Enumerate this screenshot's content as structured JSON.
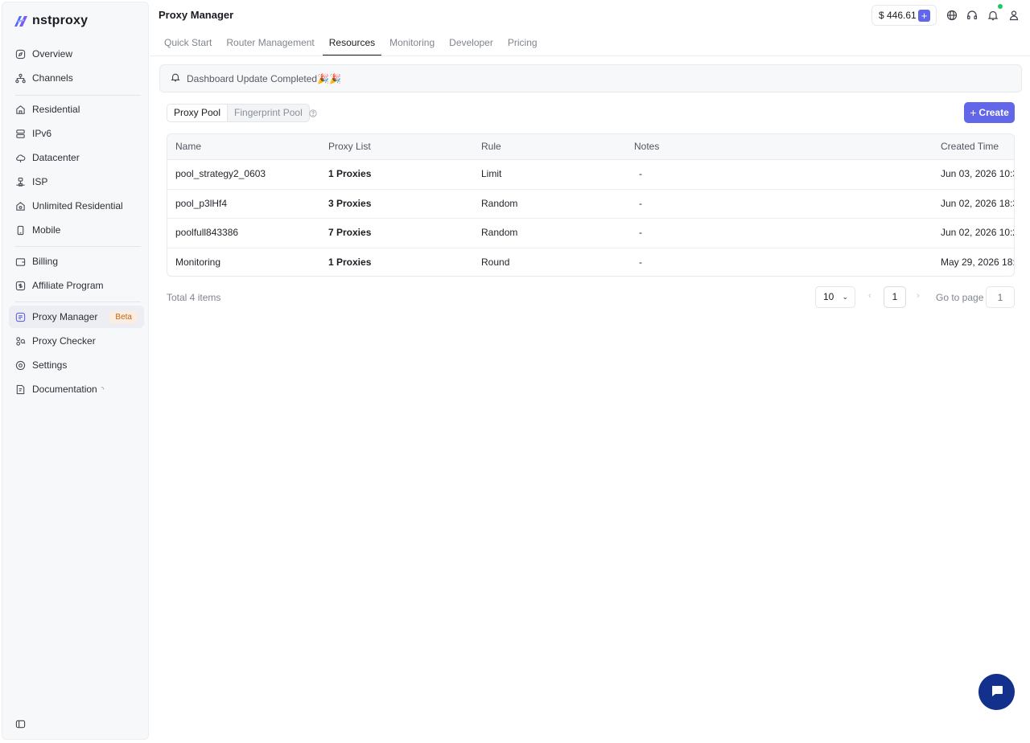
{
  "brand": {
    "name": "nstproxy"
  },
  "sidebar": {
    "items": [
      {
        "label": "Overview",
        "icon": "compass-icon"
      },
      {
        "label": "Channels",
        "icon": "hierarchy-icon"
      },
      {
        "label": "Residential",
        "icon": "home-icon"
      },
      {
        "label": "IPv6",
        "icon": "server-icon"
      },
      {
        "label": "Datacenter",
        "icon": "cloud-icon"
      },
      {
        "label": "ISP",
        "icon": "network-icon"
      },
      {
        "label": "Unlimited Residential",
        "icon": "home-infinity-icon"
      },
      {
        "label": "Mobile",
        "icon": "mobile-icon"
      },
      {
        "label": "Billing",
        "icon": "wallet-icon"
      },
      {
        "label": "Affiliate Program",
        "icon": "dollar-icon"
      },
      {
        "label": "Proxy Manager",
        "icon": "list-icon",
        "badge": "Beta",
        "active": true
      },
      {
        "label": "Proxy Checker",
        "icon": "checker-icon"
      },
      {
        "label": "Settings",
        "icon": "gear-icon"
      },
      {
        "label": "Documentation",
        "icon": "document-icon"
      }
    ]
  },
  "header": {
    "title": "Proxy Manager",
    "balance": "$ 446.61",
    "accent": "#6266e8"
  },
  "tabs": [
    {
      "label": "Quick Start"
    },
    {
      "label": "Router Management"
    },
    {
      "label": "Resources",
      "active": true
    },
    {
      "label": "Monitoring"
    },
    {
      "label": "Developer"
    },
    {
      "label": "Pricing"
    }
  ],
  "banner": {
    "text": "Dashboard Update Completed🎉🎉"
  },
  "segments": [
    {
      "label": "Proxy Pool",
      "active": true
    },
    {
      "label": "Fingerprint Pool"
    }
  ],
  "create_label": "Create",
  "table": {
    "columns": [
      "Name",
      "Proxy List",
      "Rule",
      "Notes",
      "Created Time"
    ],
    "rows": [
      {
        "name": "pool_strategy2_0603",
        "proxies": "1 Proxies",
        "rule": "Limit",
        "notes": "-",
        "created": "Jun 03, 2026 10:3"
      },
      {
        "name": "pool_p3lHf4",
        "proxies": "3 Proxies",
        "rule": "Random",
        "notes": "-",
        "created": "Jun 02, 2026 18:3"
      },
      {
        "name": "poolfull843386",
        "proxies": "7 Proxies",
        "rule": "Random",
        "notes": "-",
        "created": "Jun 02, 2026 10:2"
      },
      {
        "name": "Monitoring",
        "proxies": "1 Proxies",
        "rule": "Round",
        "notes": "-",
        "created": "May 29, 2026 18:0"
      }
    ]
  },
  "pagination": {
    "total": "Total 4 items",
    "page_size": "10",
    "current_page": "1",
    "goto_label": "Go to page",
    "goto_placeholder": "1"
  }
}
